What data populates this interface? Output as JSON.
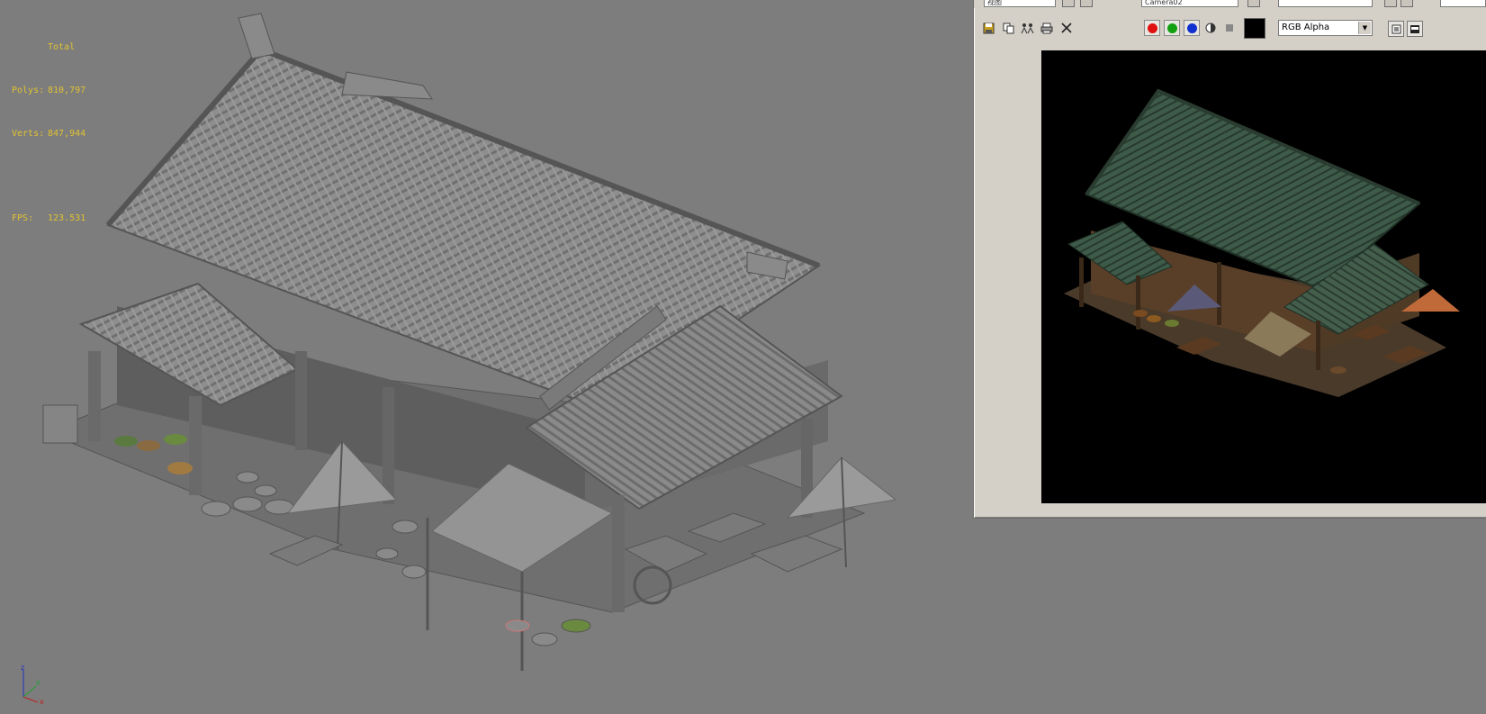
{
  "viewport": {
    "stats": {
      "total_label": "Total",
      "polys_label": "Polys:",
      "polys_value": "810,797",
      "verts_label": "Verts:",
      "verts_value": "847,944",
      "fps_label": "FPS:",
      "fps_value": "123.531"
    },
    "axis": {
      "z": "z",
      "y": "y",
      "x": "x"
    }
  },
  "render_window": {
    "view_field": "视图",
    "camera_field": "Camera02",
    "channel_select": "RGB Alpha",
    "icons": [
      "save-icon",
      "copy-icon",
      "clone-icon",
      "print-icon",
      "close-icon",
      "red-channel-icon",
      "green-channel-icon",
      "blue-channel-icon",
      "mono-icon",
      "clear-icon",
      "color-swatch-icon",
      "display-alpha-icon",
      "display-rgb-icon"
    ],
    "colors": {
      "red": "#e01010",
      "green": "#10a010",
      "blue": "#1030d0",
      "frame_bg": "#d4d0c8",
      "canvas_bg": "#000000"
    }
  },
  "colors": {
    "viewport_bg": "#7d7d7d",
    "stats_text": "#e0c232"
  }
}
